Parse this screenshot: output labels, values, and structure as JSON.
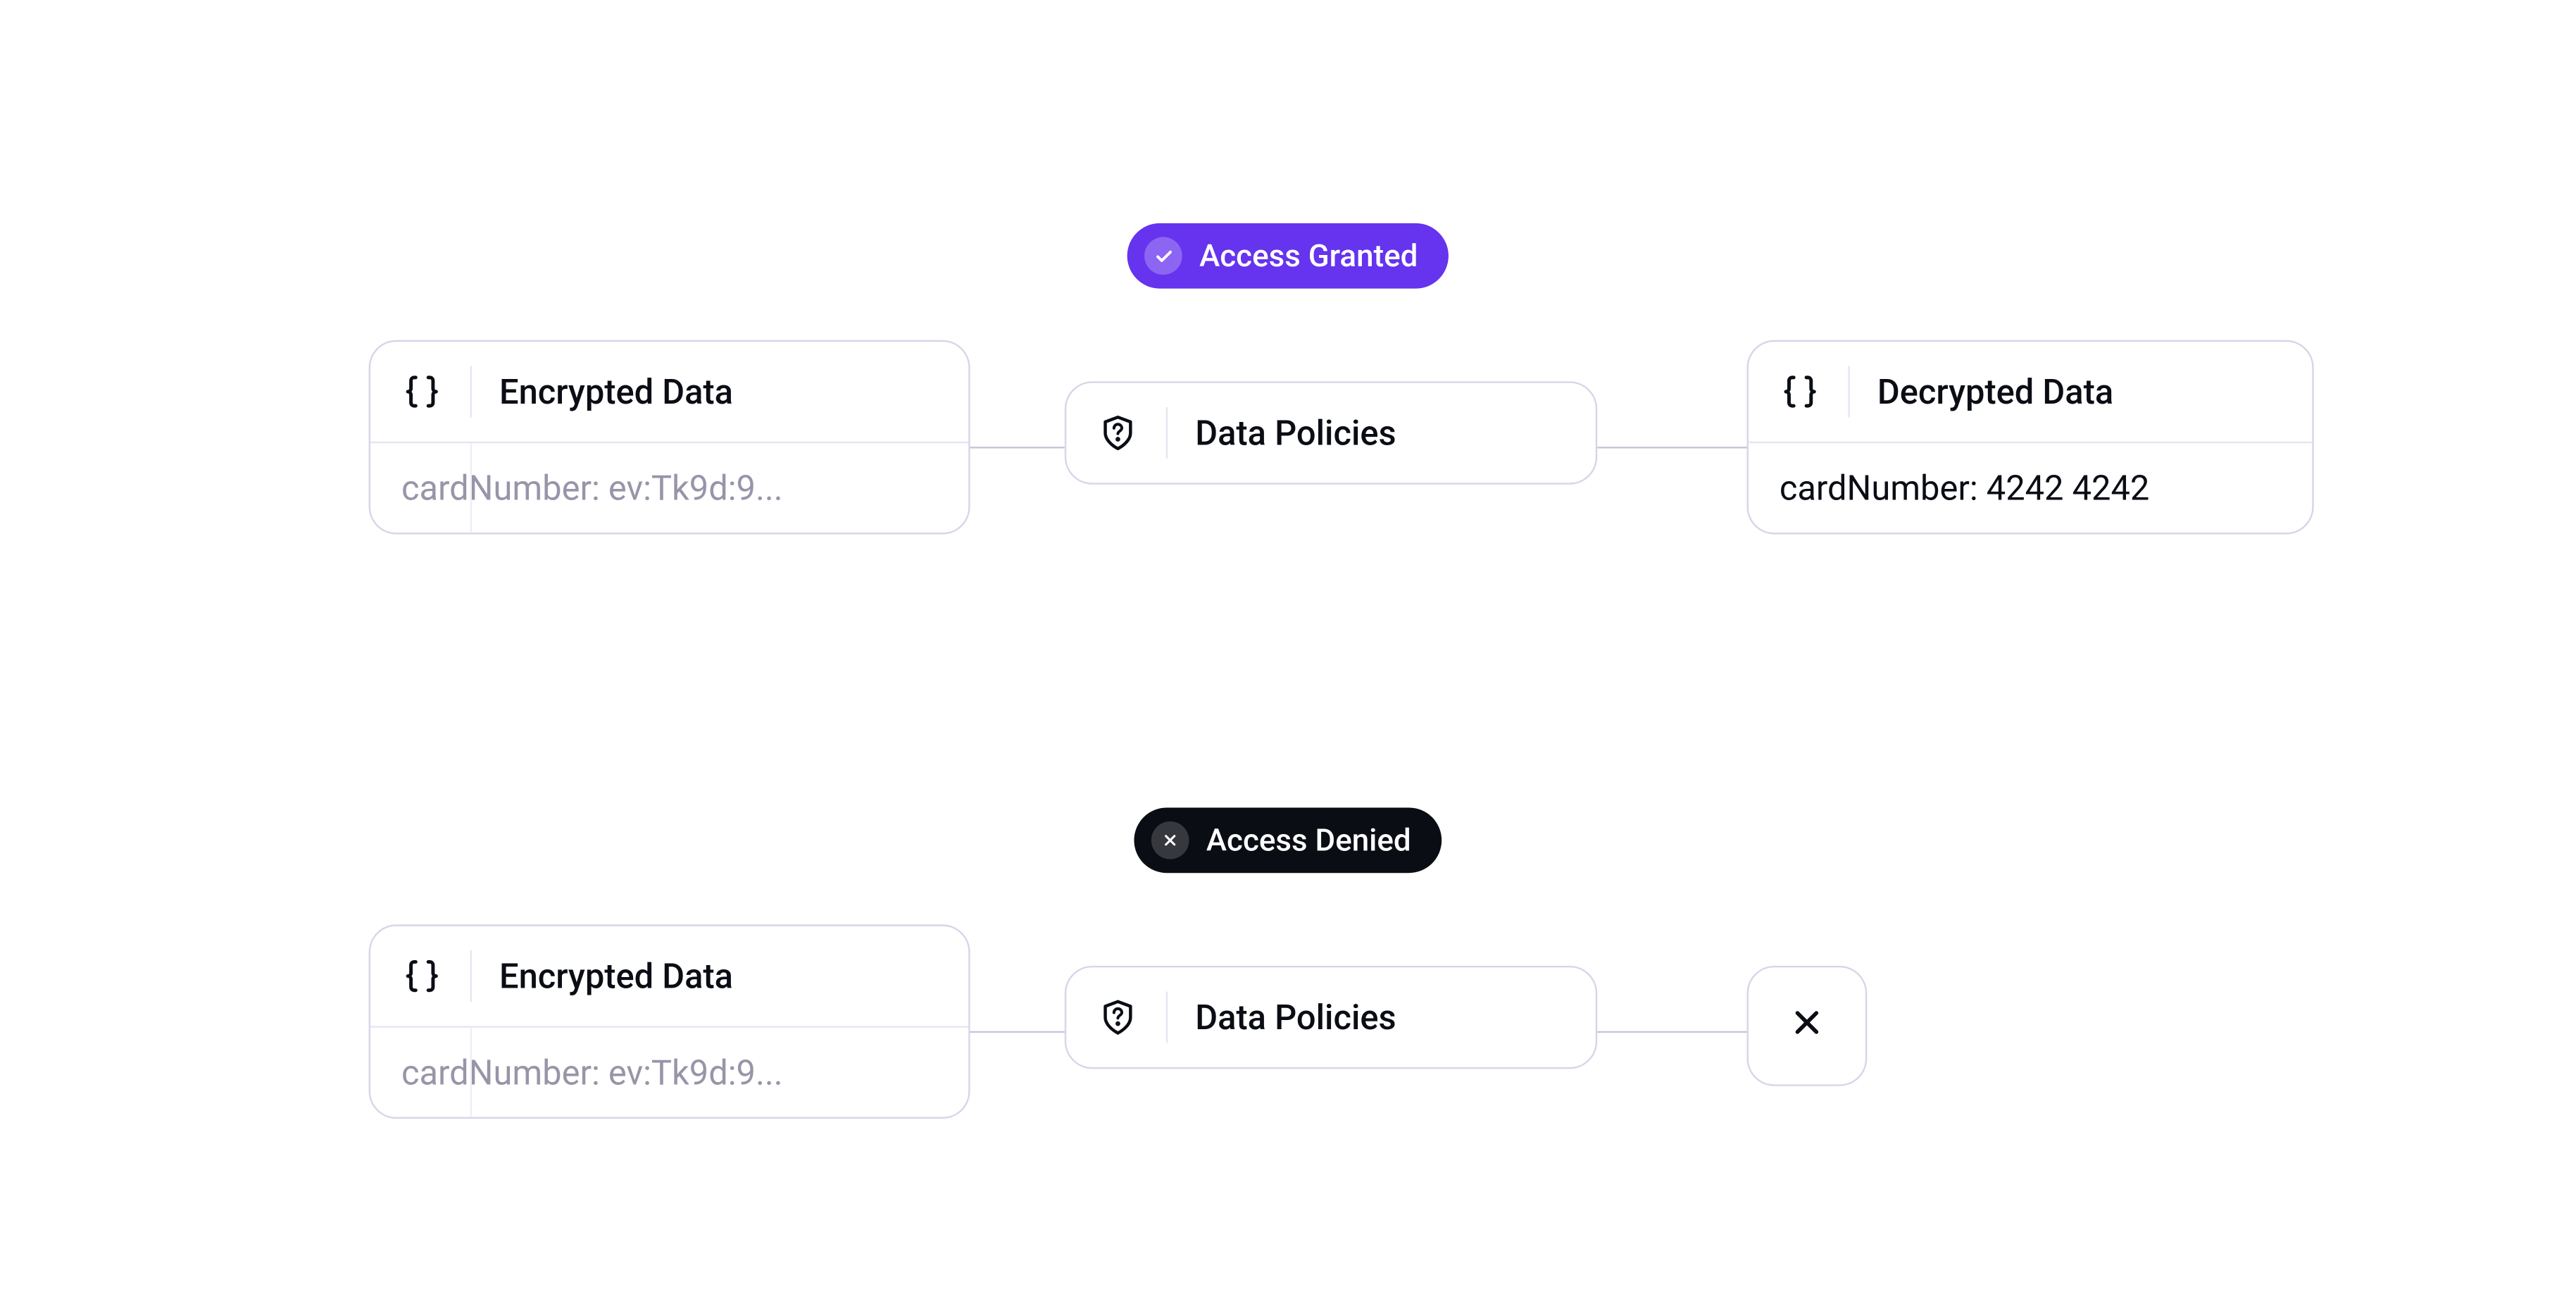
{
  "badges": {
    "granted": "Access Granted",
    "denied": "Access Denied"
  },
  "cards": {
    "encrypted": {
      "title": "Encrypted Data",
      "content": "cardNumber: ev:Tk9d:9...",
      "icon": "braces-icon"
    },
    "policies": {
      "title": "Data Policies",
      "icon": "shield-question-icon"
    },
    "decrypted": {
      "title": "Decrypted Data",
      "content": "cardNumber: 4242 4242",
      "icon": "braces-icon"
    }
  },
  "colors": {
    "accent_purple": "#6633EE",
    "badge_dark": "#0a0d14",
    "border": "#d8d5e8",
    "text_muted": "#9795a8"
  }
}
